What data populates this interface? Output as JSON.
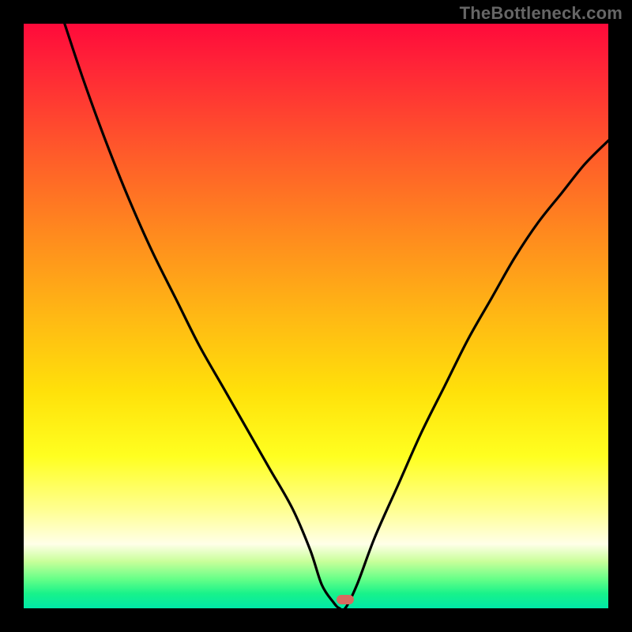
{
  "watermark": "TheBottleneck.com",
  "chart_data": {
    "type": "line",
    "title": "",
    "xlabel": "",
    "ylabel": "",
    "axes_visible": false,
    "grid": false,
    "legend": false,
    "xlim": [
      0,
      100
    ],
    "ylim": [
      0,
      100
    ],
    "background": {
      "kind": "vertical_gradient",
      "stops": [
        {
          "pos": 0,
          "color": "#ff0a3a"
        },
        {
          "pos": 22,
          "color": "#ff5a2a"
        },
        {
          "pos": 50,
          "color": "#ffb814"
        },
        {
          "pos": 74,
          "color": "#ffff20"
        },
        {
          "pos": 89,
          "color": "#ffffe8"
        },
        {
          "pos": 95,
          "color": "#66ff88"
        },
        {
          "pos": 100,
          "color": "#00e8a8"
        }
      ]
    },
    "series": [
      {
        "name": "bottleneck_curve",
        "color": "#000000",
        "x": [
          7,
          10,
          14,
          18,
          22,
          26,
          30,
          34,
          38,
          42,
          46,
          49,
          51,
          53,
          54,
          55,
          57,
          60,
          64,
          68,
          72,
          76,
          80,
          84,
          88,
          92,
          96,
          100
        ],
        "y": [
          100,
          91,
          80,
          70,
          61,
          53,
          45,
          38,
          31,
          24,
          17,
          10,
          4,
          1,
          0,
          0,
          4,
          12,
          21,
          30,
          38,
          46,
          53,
          60,
          66,
          71,
          76,
          80
        ]
      }
    ],
    "marker": {
      "x": 55,
      "y": 1.5,
      "color": "#d86b60",
      "shape": "rounded_rect"
    }
  },
  "colors": {
    "frame_bg": "#000000",
    "curve": "#000000",
    "marker": "#d86b60",
    "watermark": "#666666"
  }
}
